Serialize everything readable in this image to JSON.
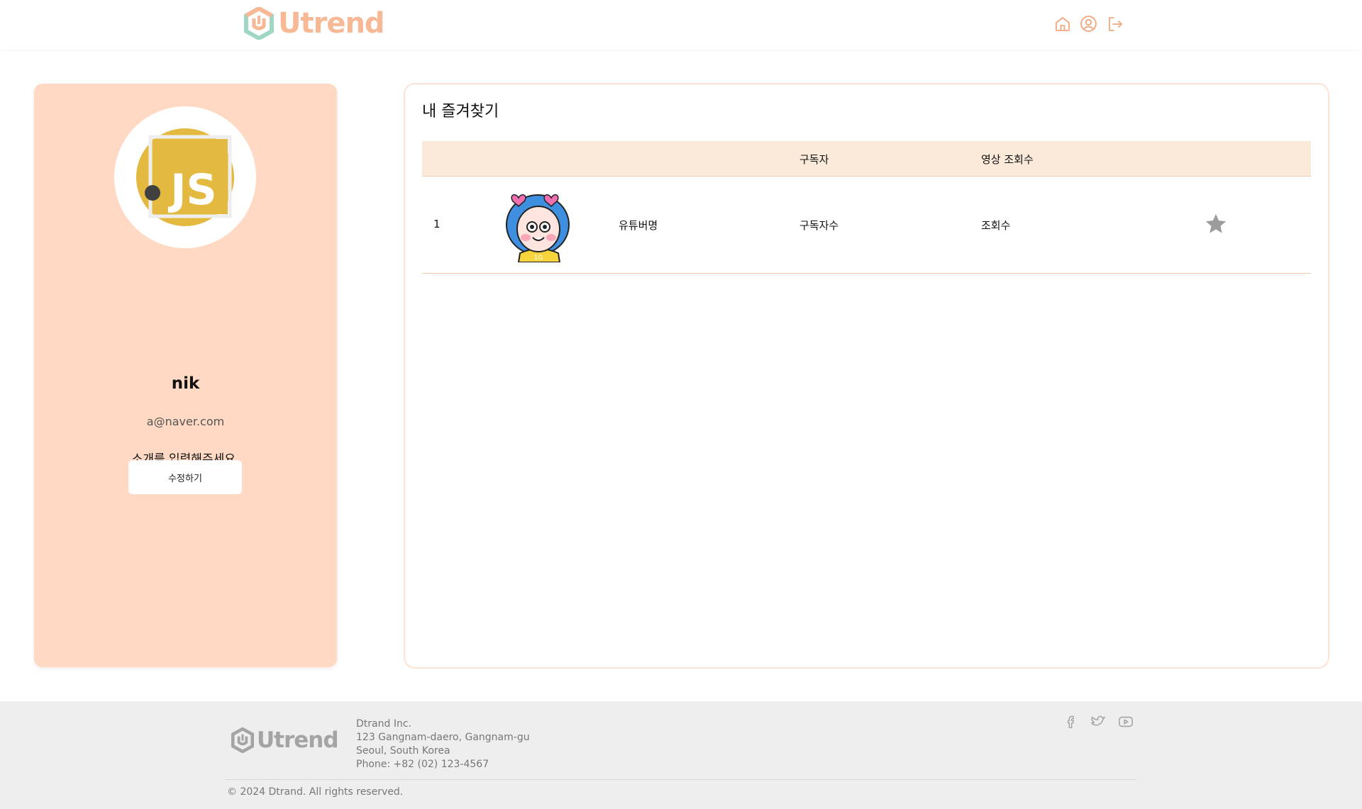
{
  "header": {
    "logo_text": "Utrend",
    "nav_icons": [
      "home-icon",
      "user-circle-icon",
      "logout-icon"
    ],
    "accent_color": "#f7b896"
  },
  "profile": {
    "avatar_icon": "javascript-logo",
    "name": "nik",
    "email": "a@naver.com",
    "intro": "소개를 입력해주세요.",
    "edit_button": "수정하기",
    "card_color": "#ffd9c3"
  },
  "favorites": {
    "title": "내 즐겨찾기",
    "columns": {
      "subscribers": "구독자",
      "views": "영상 조회수"
    },
    "rows": [
      {
        "index": "1",
        "thumbnail_icon": "cartoon-girl-avatar",
        "channel_name": "유튜버명",
        "subscribers": "구독자수",
        "views": "조회수",
        "favorited_icon": "star-icon"
      }
    ],
    "header_color": "#fbead9"
  },
  "footer": {
    "logo_text": "Utrend",
    "company": "Dtrand Inc.",
    "address_line1": "123 Gangnam-daero, Gangnam-gu",
    "address_line2": "Seoul, South Korea",
    "phone": "Phone: +82 (02) 123-4567",
    "copyright": "© 2024 Dtrand. All rights reserved.",
    "social_icons": [
      "facebook-icon",
      "twitter-icon",
      "youtube-icon"
    ]
  }
}
